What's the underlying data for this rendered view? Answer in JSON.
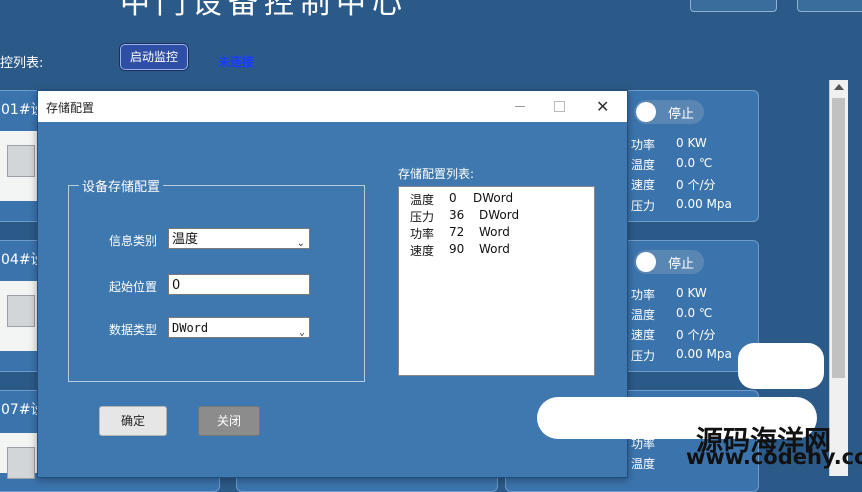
{
  "header": {
    "title": "中门设备控制中心",
    "list_label": "控列表:",
    "start_button": "启动监控",
    "connection_status": "未连接"
  },
  "devices": [
    {
      "title": "01#设"
    },
    {
      "title": "04#设"
    },
    {
      "title": "07#设"
    }
  ],
  "right_cards": [
    {
      "toggle": "停止",
      "metrics": [
        {
          "name": "功率",
          "value": "0 KW"
        },
        {
          "name": "温度",
          "value": "0.0 ℃"
        },
        {
          "name": "速度",
          "value": "0 个/分"
        },
        {
          "name": "压力",
          "value": "0.00 Mpa"
        }
      ]
    },
    {
      "toggle": "停止",
      "metrics": [
        {
          "name": "功率",
          "value": "0 KW"
        },
        {
          "name": "温度",
          "value": "0.0 ℃"
        },
        {
          "name": "速度",
          "value": "0 个/分"
        },
        {
          "name": "压力",
          "value": "0.00 Mpa"
        }
      ]
    },
    {
      "metrics": [
        {
          "name": "功率",
          "value": ""
        },
        {
          "name": "温度",
          "value": ""
        }
      ]
    }
  ],
  "dialog": {
    "title": "存储配置",
    "group_title": "设备存储配置",
    "info_type_label": "信息类别",
    "info_type_value": "温度",
    "start_pos_label": "起始位置",
    "start_pos_value": "0",
    "data_type_label": "数据类型",
    "data_type_value": "DWord",
    "list_title": "存储配置列表:",
    "list_items": [
      {
        "name": "温度",
        "pos": "0",
        "type": "DWord"
      },
      {
        "name": "压力",
        "pos": "36",
        "type": "DWord"
      },
      {
        "name": "功率",
        "pos": "72",
        "type": "Word"
      },
      {
        "name": "速度",
        "pos": "90",
        "type": "Word"
      }
    ],
    "ok_button": "确定",
    "close_button": "关闭"
  },
  "watermark": {
    "text": "源码海洋网",
    "url": "www.codehy.com"
  },
  "colors": {
    "background": "#2c5a88",
    "dialog_bg": "#3e78ae",
    "status_blue": "#1a3cff"
  }
}
